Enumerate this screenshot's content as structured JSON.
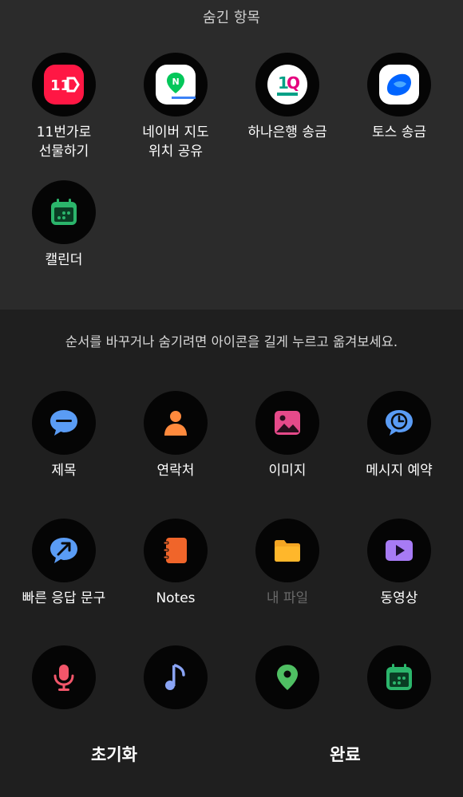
{
  "hidden_section": {
    "title": "숨긴 항목",
    "apps": [
      {
        "label": "11번가로\n선물하기",
        "icon": "11st-gift-icon"
      },
      {
        "label": "네이버 지도\n위치 공유",
        "icon": "naver-map-icon"
      },
      {
        "label": "하나은행 송금",
        "icon": "hana-bank-icon"
      },
      {
        "label": "토스 송금",
        "icon": "toss-icon"
      },
      {
        "label": "캘린더",
        "icon": "calendar-icon"
      }
    ]
  },
  "instructions": "순서를 바꾸거나 숨기려면 아이콘을 길게 누르고 옮겨보세요.",
  "visible_section": {
    "apps": [
      {
        "label": "제목",
        "icon": "subject-icon"
      },
      {
        "label": "연락처",
        "icon": "contact-icon"
      },
      {
        "label": "이미지",
        "icon": "image-icon"
      },
      {
        "label": "메시지 예약",
        "icon": "schedule-message-icon"
      },
      {
        "label": "빠른 응답 문구",
        "icon": "quick-response-icon"
      },
      {
        "label": "Notes",
        "icon": "notes-icon"
      },
      {
        "label": "내 파일",
        "icon": "my-files-icon"
      },
      {
        "label": "동영상",
        "icon": "video-icon"
      },
      {
        "label": "",
        "icon": "microphone-icon"
      },
      {
        "label": "",
        "icon": "music-icon"
      },
      {
        "label": "",
        "icon": "location-icon"
      },
      {
        "label": "",
        "icon": "calendar-icon"
      }
    ]
  },
  "buttons": {
    "reset": "초기화",
    "done": "완료"
  },
  "colors": {
    "hidden_panel_bg": "#2b2b2b",
    "main_bg": "#1f1f1f",
    "icon_circle": "#050505",
    "disabled_label": "#6a6a6a"
  }
}
